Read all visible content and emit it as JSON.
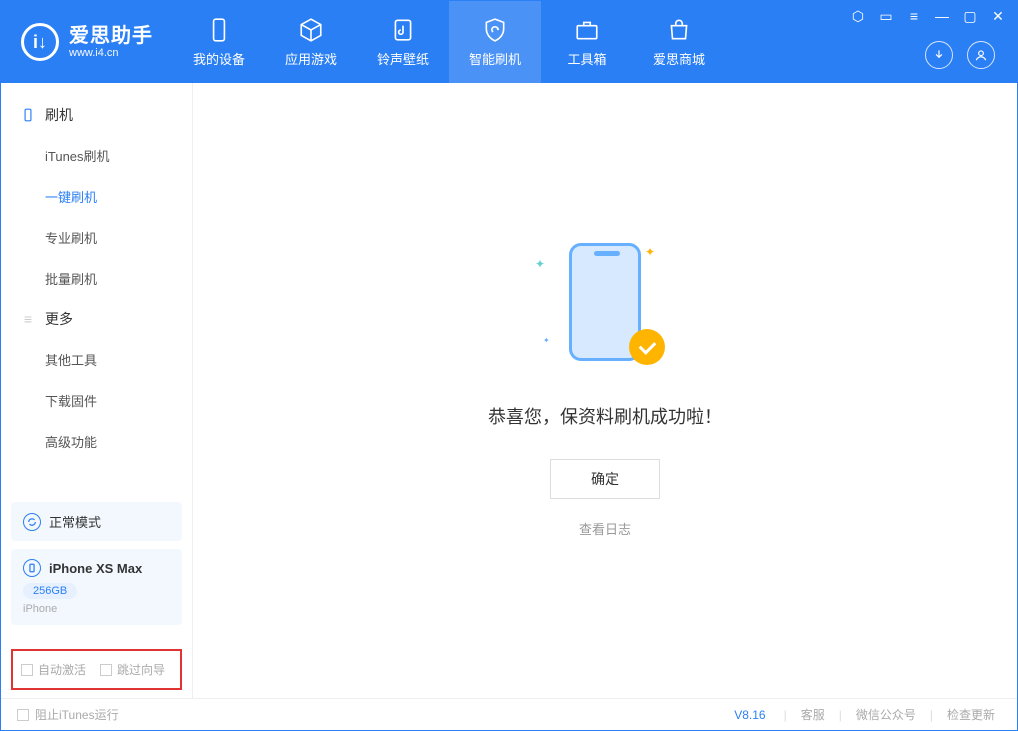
{
  "app": {
    "title": "爱思助手",
    "subtitle": "www.i4.cn"
  },
  "tabs": {
    "device": "我的设备",
    "apps": "应用游戏",
    "ring": "铃声壁纸",
    "flash": "智能刷机",
    "tools": "工具箱",
    "store": "爱思商城"
  },
  "sidebar": {
    "section_flash": "刷机",
    "items_flash": [
      "iTunes刷机",
      "一键刷机",
      "专业刷机",
      "批量刷机"
    ],
    "section_more": "更多",
    "items_more": [
      "其他工具",
      "下载固件",
      "高级功能"
    ]
  },
  "device_card": {
    "mode": "正常模式",
    "name": "iPhone XS Max",
    "storage": "256GB",
    "type": "iPhone"
  },
  "options": {
    "auto_activate": "自动激活",
    "skip_guide": "跳过向导"
  },
  "main": {
    "success": "恭喜您，保资料刷机成功啦！",
    "ok": "确定",
    "view_log": "查看日志"
  },
  "footer": {
    "block_itunes": "阻止iTunes运行",
    "version": "V8.16",
    "support": "客服",
    "wechat": "微信公众号",
    "update": "检查更新"
  }
}
